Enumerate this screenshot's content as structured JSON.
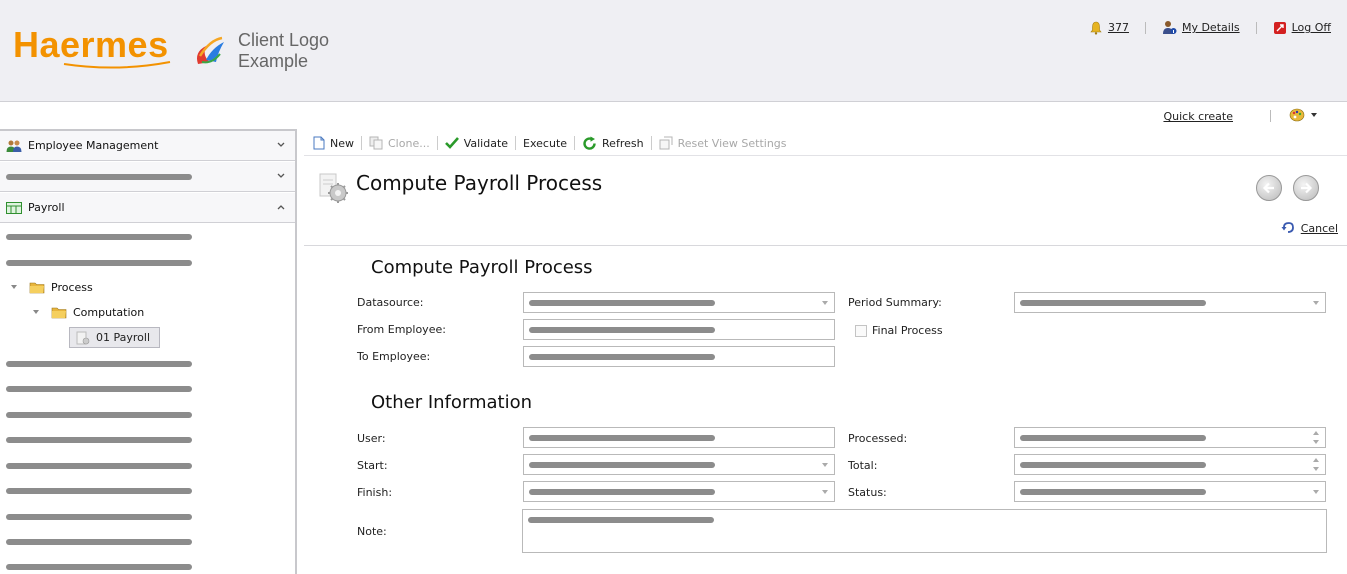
{
  "header": {
    "brand": "Haermes",
    "client_logo_line1": "Client Logo",
    "client_logo_line2": "Example",
    "notifications_count": "377",
    "my_details_label": "My Details",
    "log_off_label": "Log Off"
  },
  "subbar": {
    "quick_create_label": "Quick create"
  },
  "sidebar": {
    "employee_management_label": "Employee Management",
    "payroll_label": "Payroll",
    "tree": {
      "process_label": "Process",
      "computation_label": "Computation",
      "selected_label": "01 Payroll"
    }
  },
  "toolbar": {
    "new_label": "New",
    "clone_label": "Clone...",
    "validate_label": "Validate",
    "execute_label": "Execute",
    "refresh_label": "Refresh",
    "reset_view_label": "Reset View Settings"
  },
  "page": {
    "title": "Compute Payroll Process",
    "cancel_label": "Cancel"
  },
  "form": {
    "section1_title": "Compute Payroll Process",
    "datasource_label": "Datasource:",
    "from_employee_label": "From Employee:",
    "to_employee_label": "To Employee:",
    "period_summary_label": "Period Summary:",
    "final_process_label": "Final Process",
    "section2_title": "Other Information",
    "user_label": "User:",
    "start_label": "Start:",
    "finish_label": "Finish:",
    "note_label": "Note:",
    "processed_label": "Processed:",
    "total_label": "Total:",
    "status_label": "Status:"
  },
  "colors": {
    "brand_orange": "#f39200",
    "header_bg": "#efeff3",
    "redacted_bar": "#8c8c8c"
  }
}
